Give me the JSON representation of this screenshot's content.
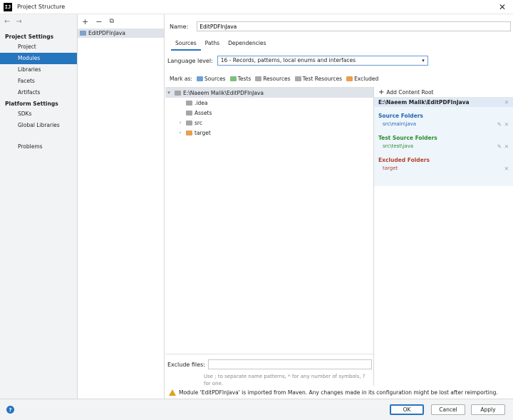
{
  "window": {
    "title": "Project Structure",
    "app_icon": "IJ"
  },
  "nav": {
    "back_label": "←",
    "forward_label": "→",
    "sections": [
      {
        "title": "Project Settings",
        "items": [
          "Project",
          "Modules",
          "Libraries",
          "Facets",
          "Artifacts"
        ]
      },
      {
        "title": "Platform Settings",
        "items": [
          "SDKs",
          "Global Libraries"
        ]
      }
    ],
    "extra_item": "Problems",
    "selected": "Modules"
  },
  "modules": {
    "add_label": "+",
    "remove_label": "−",
    "copy_label": "⧉",
    "items": [
      "EditPDFInJava"
    ]
  },
  "main": {
    "name_label": "Name:",
    "name_value": "EditPDFInJava",
    "tabs": [
      "Sources",
      "Paths",
      "Dependencies"
    ],
    "active_tab": "Sources",
    "language_level_label": "Language level:",
    "language_level_value": "16 - Records, patterns, local enums and interfaces",
    "mark_as_label": "Mark as:",
    "mark_as": [
      {
        "label": "Sources",
        "color": "#6fa0d6"
      },
      {
        "label": "Tests",
        "color": "#7cc07c"
      },
      {
        "label": "Resources",
        "color": "#a9a9a9"
      },
      {
        "label": "Test Resources",
        "color": "#a9a9a9"
      },
      {
        "label": "Excluded",
        "color": "#e89f4e"
      }
    ],
    "tree": {
      "root": "E:\\Naeem Malik\\EditPDFInJava",
      "children": [
        {
          "label": ".idea",
          "expandable": false,
          "type": "folder"
        },
        {
          "label": "Assets",
          "expandable": false,
          "type": "folder"
        },
        {
          "label": "src",
          "expandable": true,
          "type": "folder"
        },
        {
          "label": "target",
          "expandable": true,
          "type": "excluded"
        }
      ]
    },
    "exclude_files_label": "Exclude files:",
    "exclude_files_hint": "Use ; to separate name patterns, * for any number of symbols, ? for one."
  },
  "content_root": {
    "add_label": "Add Content Root",
    "path": "E:\\Naeem Malik\\EditPDFInJava",
    "source_folders_title": "Source Folders",
    "source_folders": [
      "src\\main\\java"
    ],
    "test_source_folders_title": "Test Source Folders",
    "test_source_folders": [
      "src\\test\\java"
    ],
    "excluded_folders_title": "Excluded Folders",
    "excluded_folders": [
      "target"
    ]
  },
  "warning": "Module 'EditPDFInJava' is imported from Maven. Any changes made in its configuration might be lost after reimporting.",
  "buttons": {
    "ok": "OK",
    "cancel": "Cancel",
    "apply": "Apply",
    "help": "?"
  },
  "colors": {
    "accent": "#2675bf",
    "warning": "#e0a020"
  }
}
